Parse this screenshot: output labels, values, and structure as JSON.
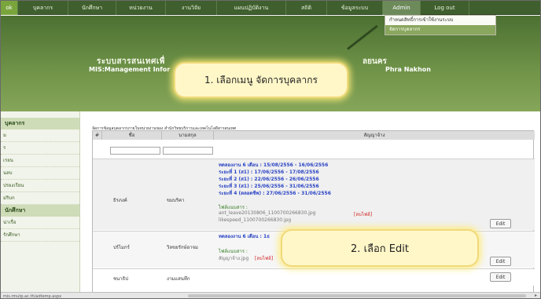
{
  "nav": {
    "items": [
      "ok",
      "บุคลากร",
      "นักศึกษา",
      "หน่วยงาน",
      "งานวิจัย",
      "แผนปฏิบัติงาน",
      "สถิติ",
      "ข้อมูลระบบ",
      "Admin",
      "Log out"
    ],
    "accent": "#3f5f2e"
  },
  "admin_menu": {
    "items": [
      "กำหนดสิทธิ์การเข้าใช้งานระบบ",
      "จัดการบุคลากร"
    ]
  },
  "banner": {
    "title_left": "ระบบสารสนเทศเพื่",
    "subtitle_left": "MIS:Management Infor",
    "title_right": "ลยนคร",
    "subtitle_right": "Phra Nakhon"
  },
  "callouts": {
    "step1": "1. เลือกเมนู จัดการบุคลากร",
    "step2": "2. เลือก Edit"
  },
  "sidebar": {
    "head1": "บุคลากร",
    "items1": [
      "ม",
      "ร",
      "เรยน",
      "นลบ",
      "ปรยงเรียน",
      "ม่ริบก"
    ],
    "head2": "นักศึกษา",
    "items2": [
      "น่าเรื่อ",
      "รักศึกษา"
    ]
  },
  "breadcrumb": "จัดการข้อมูลบุคลากรภายในหน่วยงานของ สำนักวิทยบริการและเทคโนโลยีสารสนเทศ",
  "table": {
    "headers": [
      "#",
      "ชื่อ",
      "นามสกุล",
      "สัญญาจ้าง"
    ],
    "rows": [
      {
        "first": "ธิรภงค์",
        "last": "ขมบริคา",
        "contract_lines": [
          "ทดลองงาน 6 เดือน : 15/08/2556 - 16/06/2556",
          "ระยะที่ 1 (ส1) : 17/06/2556 - 17/08/2556",
          "ระยะที่ 2 (ส1) : 22/06/2556 - 26/06/2556",
          "ระยะที่ 3 (ส1) : 25/06/2556 - 31/06/2556",
          "ระยะที่ 4 (ตลอดชีพ) : 27/06/2556 - 31/06/2556"
        ],
        "attach_label": "ไฟล์แนบสาร :",
        "files": [
          "ant_leave20130806_1100700266830.jpg",
          "likespeed_1100700266830.jpg"
        ],
        "delete_label": "[ลบไฟล์]",
        "edit": "Edit"
      },
      {
        "first": "ปร์ไมกร์",
        "last": "วิลขยรักษ์อาจม",
        "contract_lines": [
          "ทดลองงาน 6 เดือน : 1ธ"
        ],
        "attach_label": "ไฟล์แนบสาร :",
        "files": [
          "สัญญาจ้าง.jpg"
        ],
        "delete_label": "[ลบไฟล์]",
        "edit": "Edit"
      },
      {
        "first": "ชนาธิป",
        "last": "งามแสนทึก",
        "contract_lines": [],
        "files": [],
        "edit": "Edit"
      }
    ]
  },
  "status_url": "mis.rmutp.ac.th/adtemp.aspx"
}
